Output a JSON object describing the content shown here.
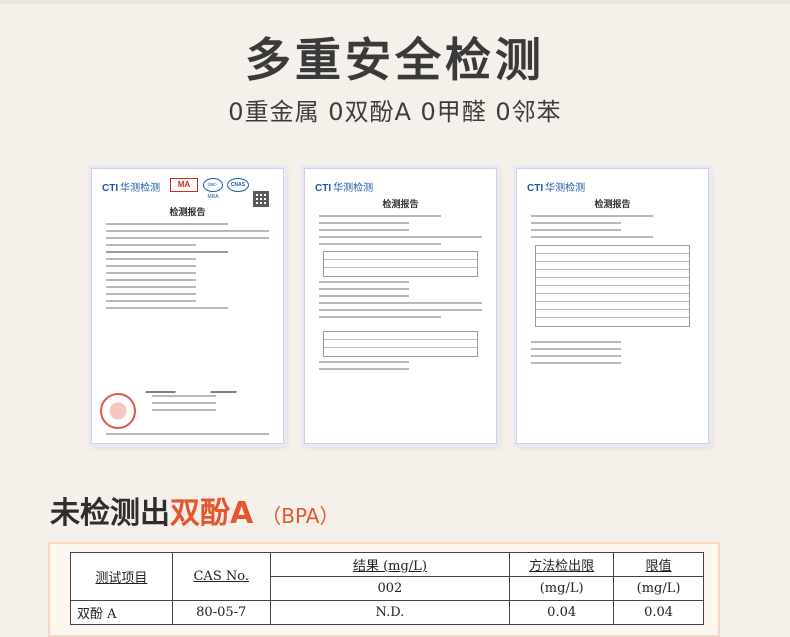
{
  "header": {
    "title": "多重安全检测",
    "subtitle": "0重金属 0双酚A 0甲醛 0邻苯"
  },
  "reports": [
    {
      "logo_prefix": "CTI",
      "logo_name": "华测检测",
      "badges": [
        "MA",
        "ilac-MRA",
        "CNAS"
      ],
      "doc_title": "检测报告"
    },
    {
      "logo_prefix": "CTI",
      "logo_name": "华测检测",
      "doc_title": "检测报告"
    },
    {
      "logo_prefix": "CTI",
      "logo_name": "华测检测",
      "doc_title": "检测报告"
    }
  ],
  "section": {
    "title_prefix": "未检测出",
    "title_accent": "双酚A",
    "note": "（BPA）"
  },
  "result_table": {
    "headers": {
      "item": "测试项目",
      "cas": "CAS No.",
      "result": "结果 (mg/L)",
      "result_sample": "002",
      "mdl": "方法检出限",
      "mdl_unit": "(mg/L)",
      "limit": "限值",
      "limit_unit": "(mg/L)"
    },
    "rows": [
      {
        "item": "双酚 A",
        "cas": "80-05-7",
        "result": "N.D.",
        "mdl": "0.04",
        "limit": "0.04"
      }
    ]
  },
  "colors": {
    "accent": "#e4572e",
    "background": "#f6f0ea",
    "logo_blue": "#1c57a5",
    "stamp_red": "#e0554e"
  }
}
